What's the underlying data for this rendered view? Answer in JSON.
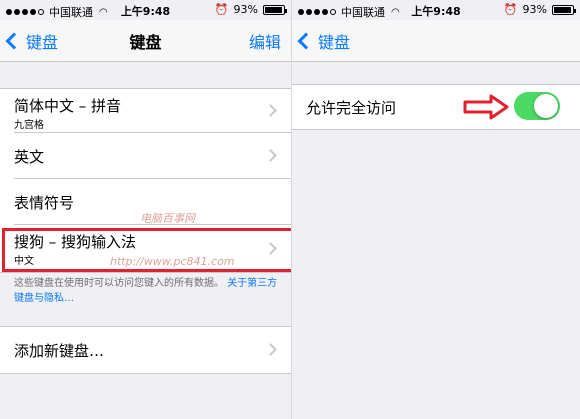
{
  "left": {
    "status": {
      "carrier": "中国联通",
      "time": "上午9:48",
      "battery": "93%",
      "battery_level": 0.93
    },
    "nav": {
      "back": "键盘",
      "title": "键盘",
      "edit": "编辑"
    },
    "keyboards": [
      {
        "label": "简体中文 – 拼音",
        "sub": "九宫格"
      },
      {
        "label": "英文",
        "sub": ""
      },
      {
        "label": "表情符号",
        "sub": ""
      },
      {
        "label": "搜狗 – 搜狗输入法",
        "sub": "中文"
      }
    ],
    "note": {
      "text": "这些键盘在使用时可以访问您键入的所有数据。",
      "link": "关于第三方键盘与隐私…"
    },
    "add_keyboard": "添加新键盘…"
  },
  "right": {
    "status": {
      "carrier": "中国联通",
      "time": "上午9:48",
      "battery": "93%",
      "battery_level": 0.93
    },
    "nav": {
      "back": "键盘"
    },
    "full_access": {
      "label": "允许完全访问",
      "enabled": true
    }
  },
  "watermark": {
    "text": "电脑百事网",
    "url": "http://www.pc841.com"
  },
  "colors": {
    "accent": "#0a7aff",
    "toggle_on": "#4cd964",
    "highlight": "#e2212e"
  },
  "icons": [
    "signal-dots-icon",
    "wifi-icon",
    "alarm-icon",
    "battery-icon",
    "chevron-left-icon",
    "chevron-right-icon",
    "red-arrow-icon"
  ]
}
